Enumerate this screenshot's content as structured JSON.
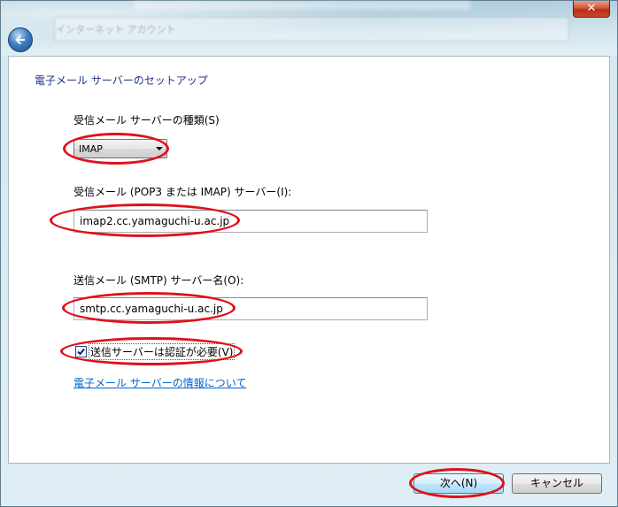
{
  "window": {
    "close_symbol": "✕",
    "ghost_title": "インターネット アカウント"
  },
  "page": {
    "heading": "電子メール サーバーのセットアップ",
    "incoming_type_label": "受信メール サーバーの種類(S)",
    "incoming_type_value": "IMAP",
    "incoming_server_label": "受信メール (POP3 または IMAP) サーバー(I):",
    "incoming_server_value": "imap2.cc.yamaguchi-u.ac.jp",
    "outgoing_server_label": "送信メール (SMTP) サーバー名(O):",
    "outgoing_server_value": "smtp.cc.yamaguchi-u.ac.jp",
    "auth_checkbox_label": "送信サーバーは認証が必要(V)",
    "auth_checkbox_checked": true,
    "info_link": "電子メール サーバーの情報について"
  },
  "footer": {
    "next_label": "次へ(N)",
    "cancel_label": "キャンセル"
  },
  "colors": {
    "highlight": "#e0101a",
    "heading": "#1e3287",
    "link": "#0066cc"
  }
}
